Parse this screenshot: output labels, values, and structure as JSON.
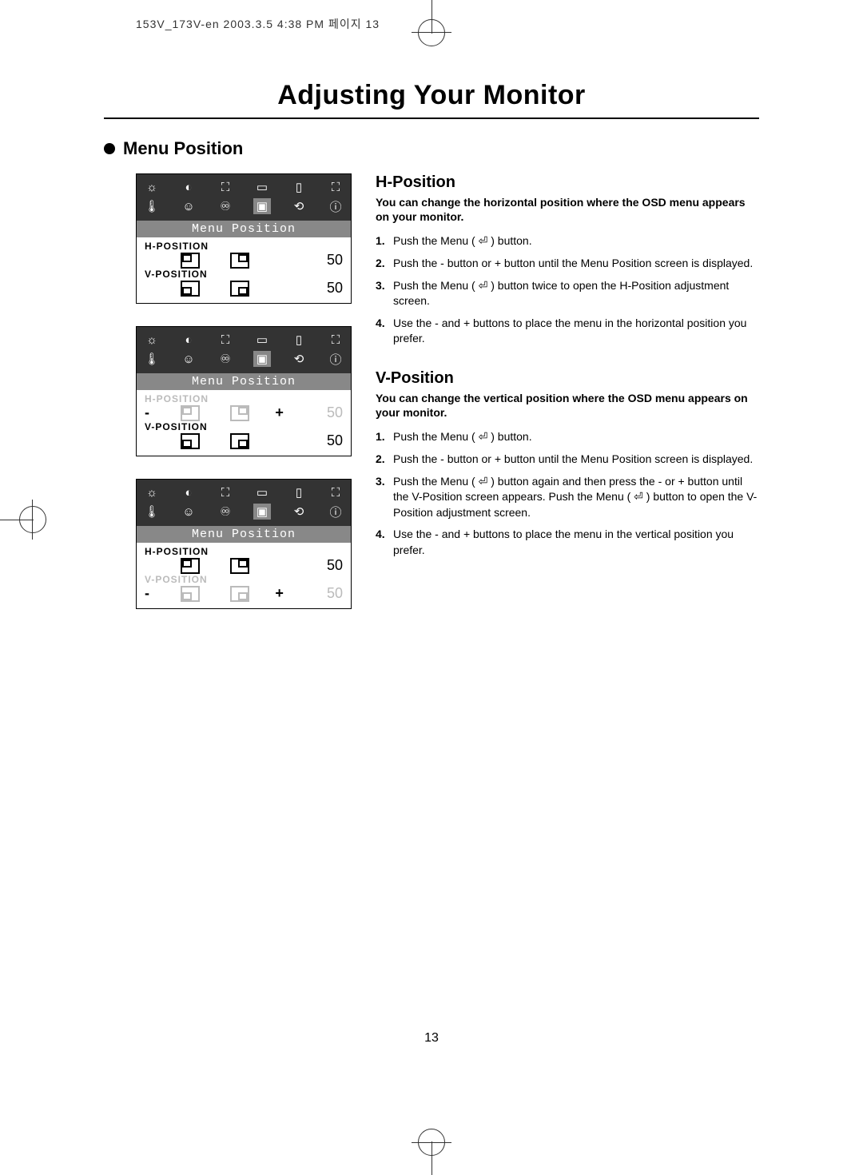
{
  "crop_header": "153V_173V-en  2003.3.5 4:38 PM  페이지 13",
  "title": "Adjusting Your Monitor",
  "section": "Menu Position",
  "osd": {
    "menu_label": "Menu Position",
    "h_label": "H-POSITION",
    "v_label": "V-POSITION",
    "h_value": "50",
    "v_value": "50"
  },
  "h_position": {
    "heading": "H-Position",
    "intro": "You can change the horizontal position where the OSD menu appears on your monitor.",
    "steps": [
      "Push the Menu ( ⏎ ) button.",
      "Push the - button or + button until the Menu Position screen is displayed.",
      "Push the Menu ( ⏎ ) button twice to open the H-Position adjustment screen.",
      "Use the - and + buttons to place the menu in the horizontal position you prefer."
    ]
  },
  "v_position": {
    "heading": "V-Position",
    "intro": "You can change the vertical position where the OSD menu appears on your monitor.",
    "steps": [
      "Push the Menu ( ⏎ ) button.",
      "Push the - button or + button until the Menu Position screen is displayed.",
      "Push the Menu ( ⏎ ) button again and then press the - or + button until the V-Position screen appears. Push the Menu ( ⏎ ) button to open the V-Position adjustment screen.",
      "Use the - and + buttons to place the menu in the vertical position you prefer."
    ]
  },
  "page_number": "13"
}
